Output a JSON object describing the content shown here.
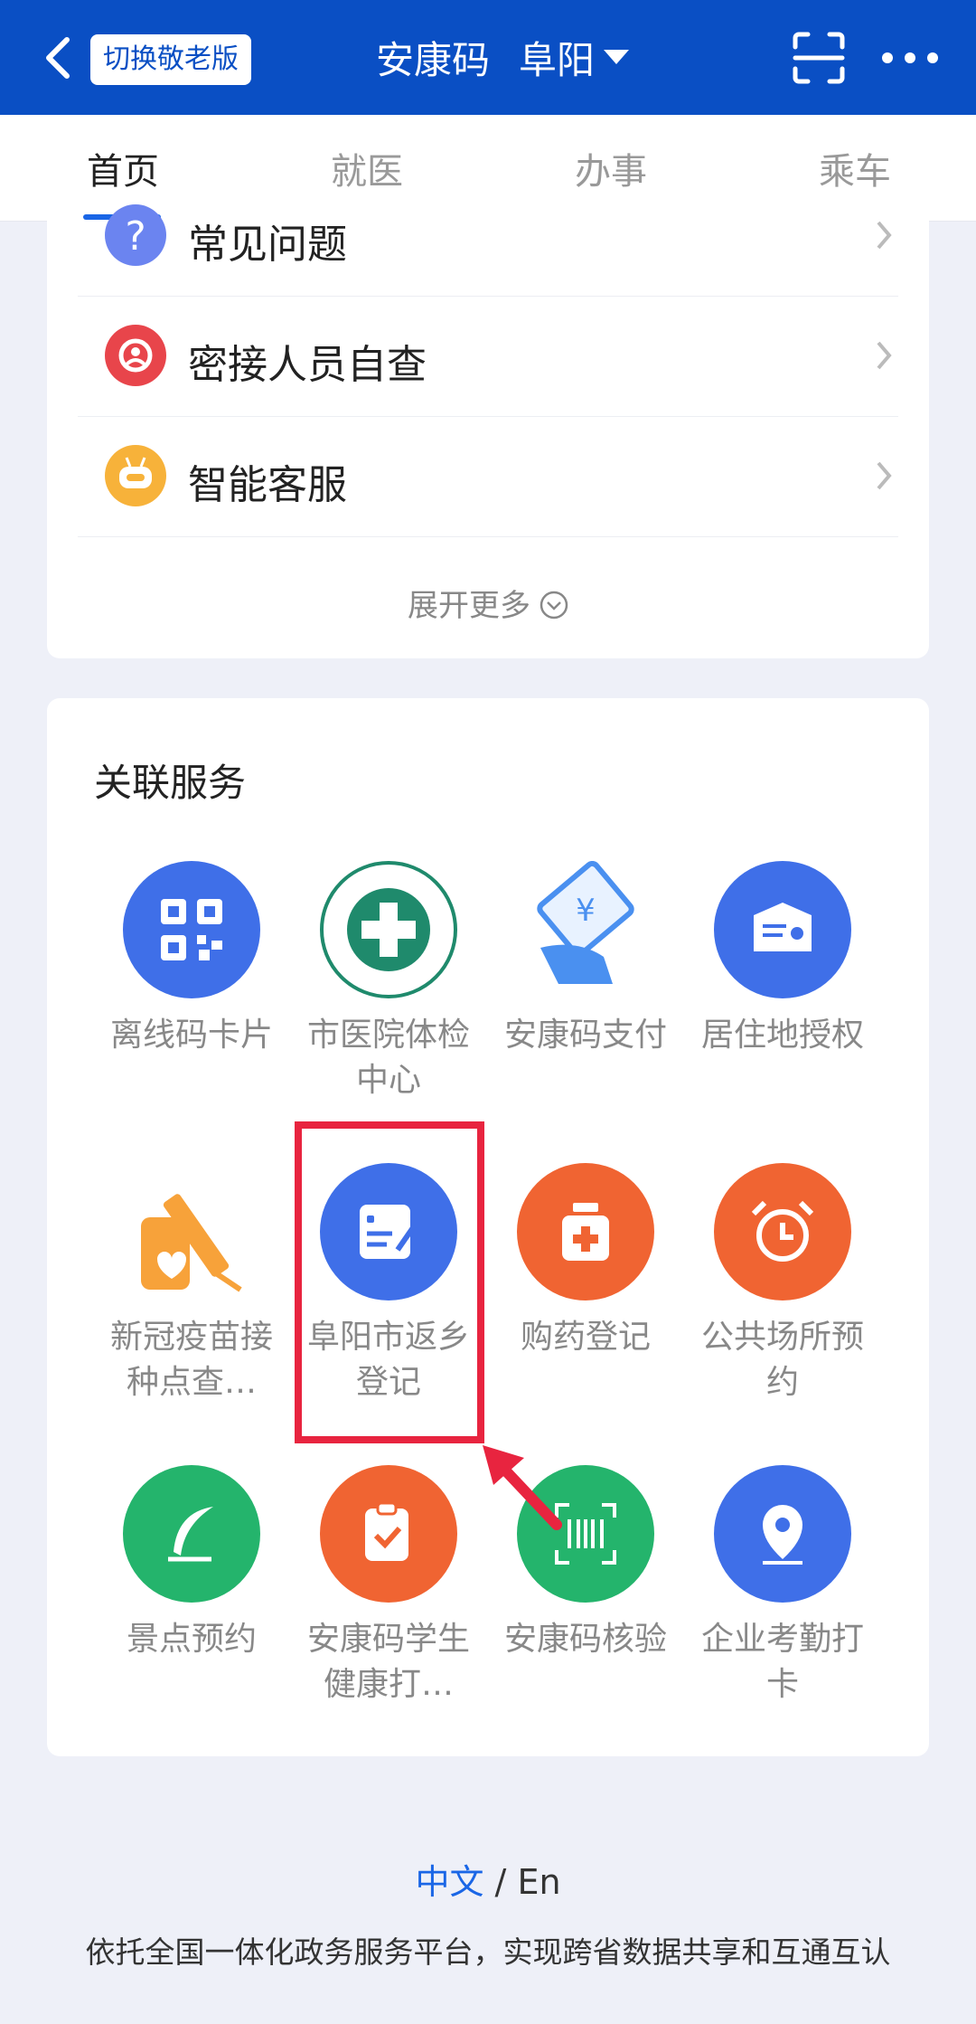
{
  "header": {
    "elder_mode_label": "切换敬老版",
    "title": "安康码",
    "city": "阜阳",
    "back_icon": "chevron-left-icon",
    "scan_icon": "scan-icon",
    "more_icon": "more-dots-icon",
    "bg_color": "#0a4fc4"
  },
  "tabs": [
    {
      "label": "首页",
      "active": true
    },
    {
      "label": "就医",
      "active": false
    },
    {
      "label": "办事",
      "active": false
    },
    {
      "label": "乘车",
      "active": false
    }
  ],
  "quick_list": [
    {
      "label": "常见问题",
      "icon": "question-icon"
    },
    {
      "label": "密接人员自查",
      "icon": "contact-check-icon"
    },
    {
      "label": "智能客服",
      "icon": "robot-icon"
    }
  ],
  "expand_more": "展开更多",
  "related": {
    "title": "关联服务",
    "items": [
      {
        "label": "离线码卡片",
        "icon": "qr-code-icon"
      },
      {
        "label": "市医院体检中心",
        "icon": "hospital-logo-icon"
      },
      {
        "label": "安康码支付",
        "icon": "payment-icon"
      },
      {
        "label": "居住地授权",
        "icon": "residence-certificate-icon"
      },
      {
        "label": "新冠疫苗接种点查…",
        "icon": "vaccine-icon"
      },
      {
        "label": "阜阳市返乡登记",
        "icon": "registration-form-icon"
      },
      {
        "label": "购药登记",
        "icon": "medicine-bottle-icon"
      },
      {
        "label": "公共场所预约",
        "icon": "alarm-clock-icon"
      },
      {
        "label": "景点预约",
        "icon": "feather-icon"
      },
      {
        "label": "安康码学生健康打…",
        "icon": "clipboard-check-icon"
      },
      {
        "label": "安康码核验",
        "icon": "barcode-scan-icon"
      },
      {
        "label": "企业考勤打卡",
        "icon": "location-pin-icon"
      }
    ]
  },
  "footer": {
    "lang_zh": "中文",
    "lang_sep": "/",
    "lang_en": "En",
    "description": "依托全国一体化政务服务平台，实现跨省数据共享和互通互认"
  }
}
